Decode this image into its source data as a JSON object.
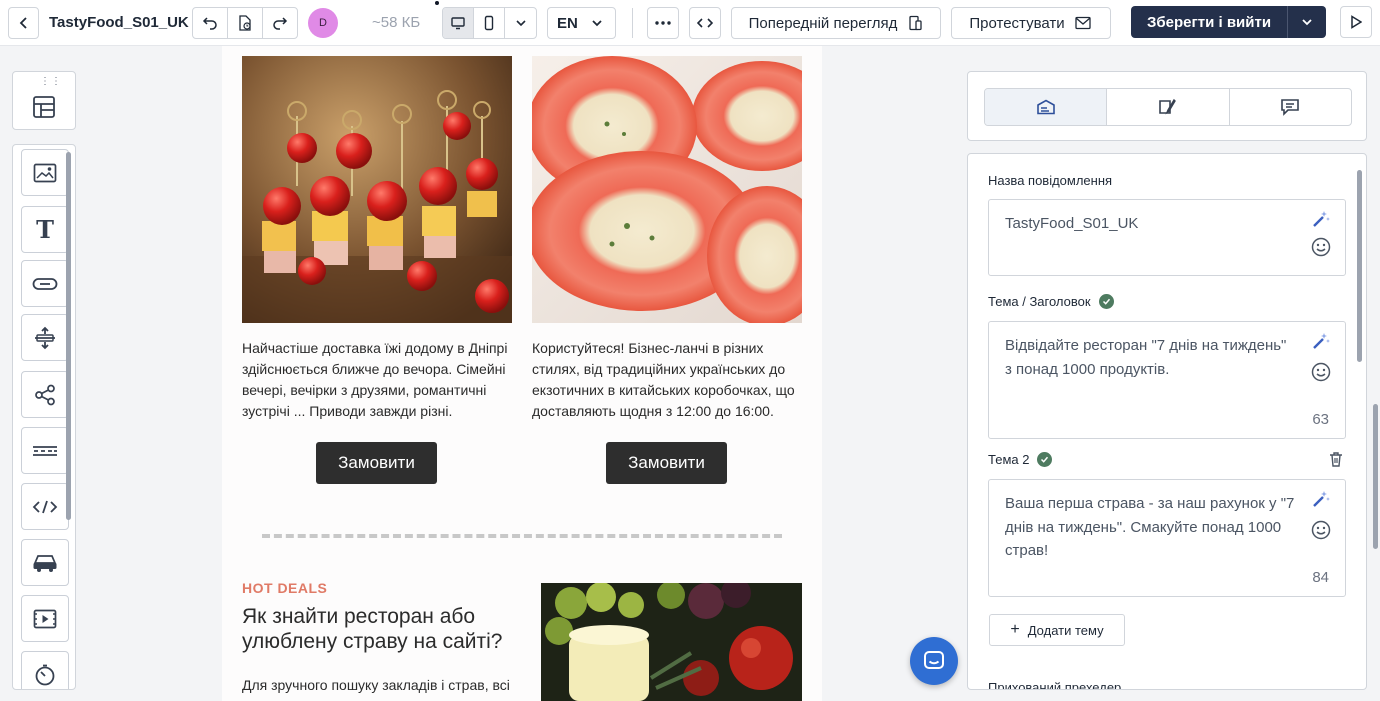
{
  "topbar": {
    "title": "TastyFood_S01_UK",
    "avatar_initial": "D",
    "size": "~58 КБ",
    "language": "EN",
    "preview_label": "Попередній перегляд",
    "test_label": "Протестувати",
    "save_label": "Зберегти і вийти",
    "accent_color": "#24304b"
  },
  "left_toolbar": {
    "top_tool": "layout-grid-icon",
    "tools": [
      "image-block-icon",
      "text-block-icon",
      "button-block-icon",
      "spacer-block-icon",
      "social-block-icon",
      "divider-block-icon",
      "html-block-icon",
      "menu-block-icon",
      "video-block-icon",
      "timer-block-icon"
    ]
  },
  "email": {
    "col1": {
      "text": "Найчастіше доставка їжі додому в Дніпрі здійснюється ближче до вечора. Сімейні вечері, вечірки з друзями, романтичні зустрічі ... Приводи завжди різні.",
      "button": "Замовити"
    },
    "col2": {
      "text": "Користуйтеся! Бізнес-ланчі в різних стилях, від традиційних українських до екзотичних в китайських коробочках, що доставляють щодня з 12:00 до 16:00.",
      "button": "Замовити"
    },
    "hot_deals": "HOT DEALS",
    "heading": "Як знайти ресторан або улюблену страву на сайті?",
    "body": "Для зручного пошуку закладів і страв, всі"
  },
  "settings": {
    "tabs": [
      "envelope-settings-icon",
      "design-settings-icon",
      "comments-icon"
    ],
    "message_name_label": "Назва повідомлення",
    "message_name_value": "TastyFood_S01_UK",
    "subject_label": "Тема / Заголовок",
    "subject_value": "Відвідайте ресторан \"7 днів на тиждень\" з понад 1000 продуктів.",
    "subject_count": "63",
    "subject2_label": "Тема 2",
    "subject2_value": "Ваша перша страва - за наш рахунок у \"7 днів на тиждень\". Смакуйте понад 1000 страв!",
    "subject2_count": "84",
    "add_subject_label": "Додати тему",
    "preheader_label": "Прихований прехедер"
  }
}
